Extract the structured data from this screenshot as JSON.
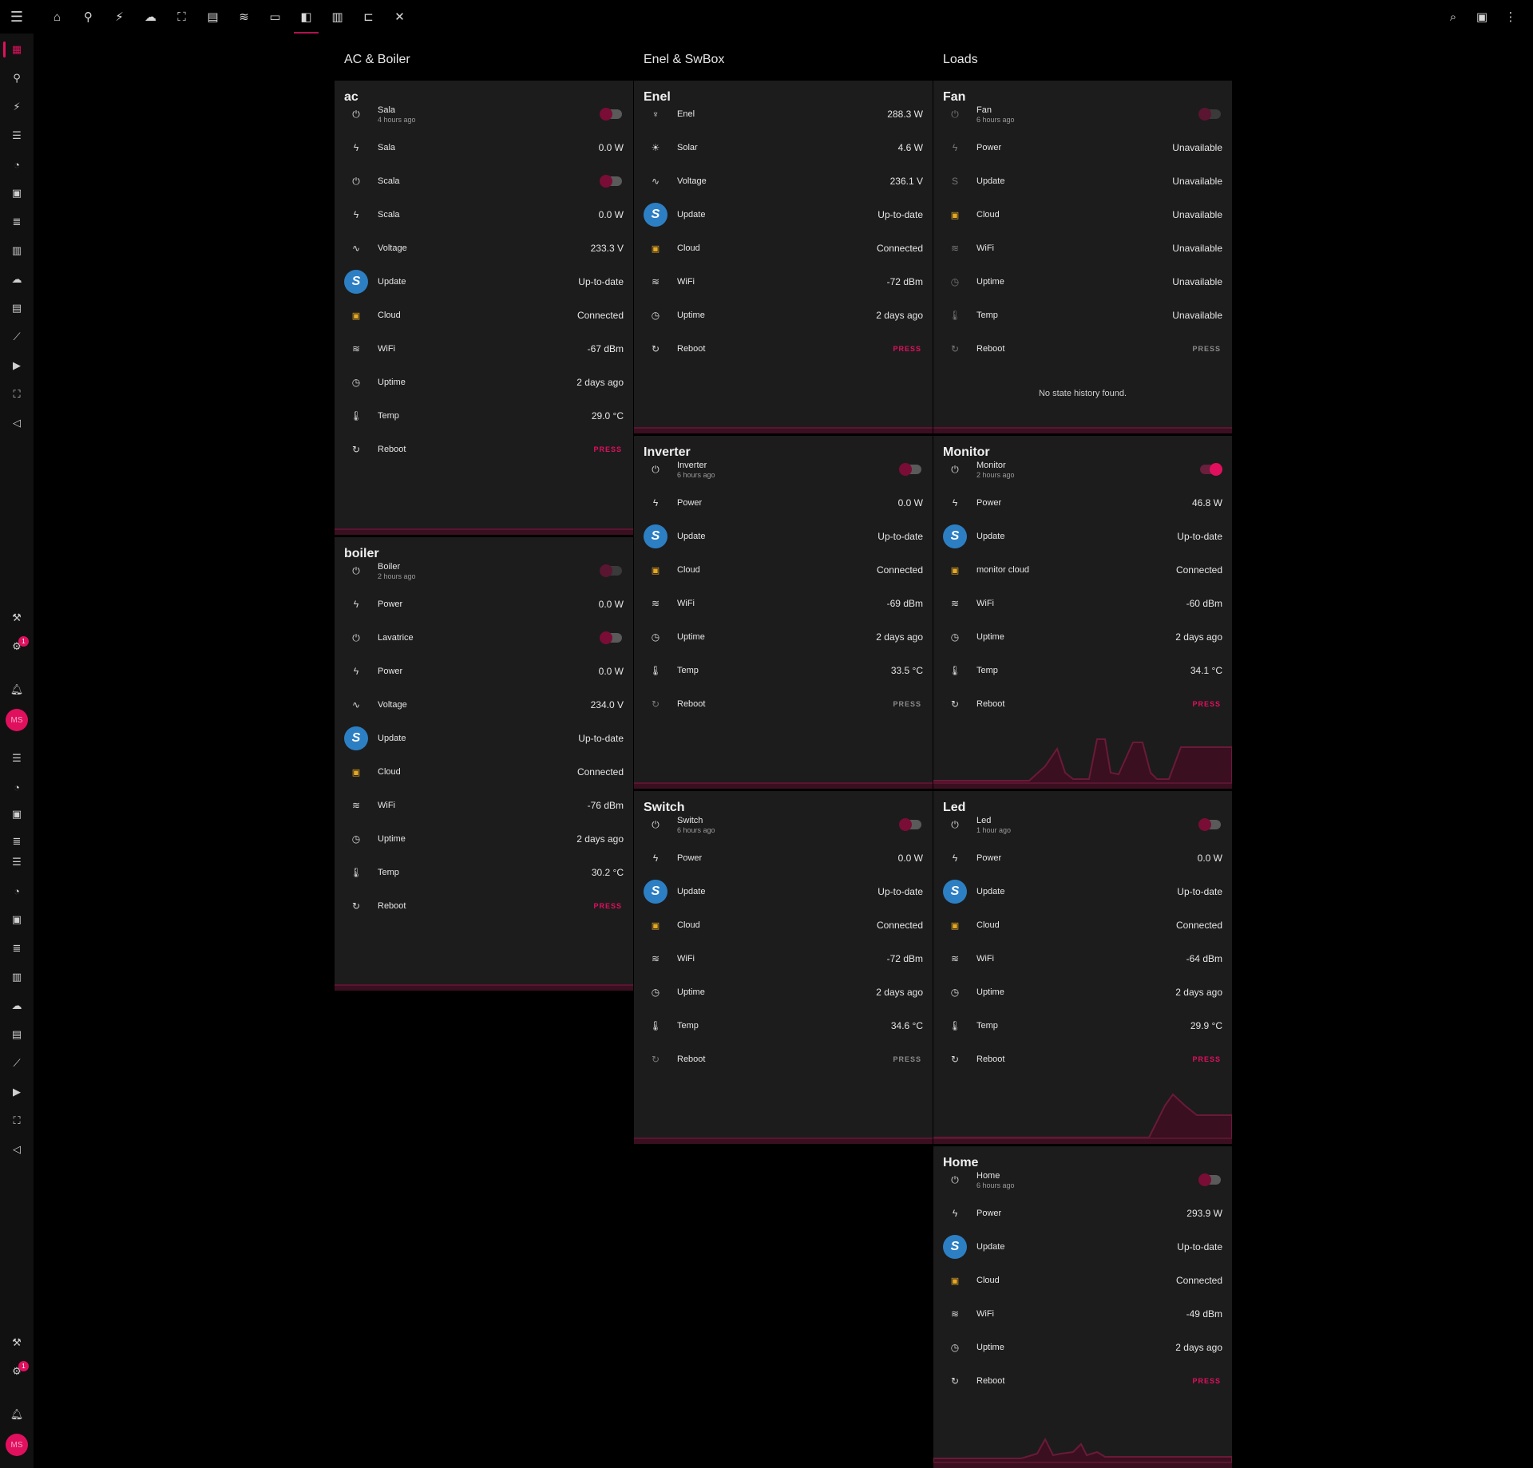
{
  "topbar": {
    "menu_icon": "menu-icon",
    "tabs": [
      {
        "icon": "home-icon",
        "glyph": "⌂"
      },
      {
        "icon": "satellite-dish-icon",
        "glyph": "⚘"
      },
      {
        "icon": "power-plug-icon",
        "glyph": "✎"
      },
      {
        "icon": "weather-partly-cloudy-icon",
        "glyph": "☁"
      },
      {
        "icon": "lan-icon",
        "glyph": "⛶"
      },
      {
        "icon": "printer-icon",
        "glyph": "▤"
      },
      {
        "icon": "radiator-icon",
        "glyph": "≋"
      },
      {
        "icon": "cast-icon",
        "glyph": "▭"
      },
      {
        "icon": "nintendo-switch-icon",
        "glyph": "◧"
      },
      {
        "icon": "book-open-icon",
        "glyph": "▥"
      },
      {
        "icon": "file-tree-icon",
        "glyph": "⊏"
      },
      {
        "icon": "tools-icon",
        "glyph": "✕"
      }
    ],
    "active_tab": 8,
    "right_icons": [
      "search-icon",
      "assist-icon",
      "more-vert-icon"
    ]
  },
  "sidebar": {
    "avatar_initials": "MS",
    "badge_count": "1"
  },
  "columns": {
    "col1": "AC & Boiler",
    "col2": "Enel & SwBox",
    "col3": "Loads"
  },
  "cards": {
    "ac": {
      "title": "ac",
      "rows": [
        {
          "label": "Sala",
          "sub": "4 hours ago"
        },
        {
          "label": "Sala",
          "value": "0.0 W"
        },
        {
          "label": "Scala"
        },
        {
          "label": "Scala",
          "value": "0.0 W"
        },
        {
          "label": "Voltage",
          "value": "233.3 V"
        },
        {
          "label": "Update",
          "value": "Up-to-date"
        },
        {
          "label": "Cloud",
          "value": "Connected"
        },
        {
          "label": "WiFi",
          "value": "-67 dBm"
        },
        {
          "label": "Uptime",
          "value": "2 days ago"
        },
        {
          "label": "Temp",
          "value": "29.0 °C"
        },
        {
          "label": "Reboot",
          "value": "PRESS"
        }
      ]
    },
    "boiler": {
      "title": "boiler",
      "rows": [
        {
          "label": "Boiler",
          "sub": "2 hours ago"
        },
        {
          "label": "Power",
          "value": "0.0 W"
        },
        {
          "label": "Lavatrice"
        },
        {
          "label": "Power",
          "value": "0.0 W"
        },
        {
          "label": "Voltage",
          "value": "234.0 V"
        },
        {
          "label": "Update",
          "value": "Up-to-date"
        },
        {
          "label": "Cloud",
          "value": "Connected"
        },
        {
          "label": "WiFi",
          "value": "-76 dBm"
        },
        {
          "label": "Uptime",
          "value": "2 days ago"
        },
        {
          "label": "Temp",
          "value": "30.2 °C"
        },
        {
          "label": "Reboot",
          "value": "PRESS"
        }
      ]
    },
    "enel": {
      "title": "Enel",
      "rows": [
        {
          "label": "Enel",
          "value": "288.3 W"
        },
        {
          "label": "Solar",
          "value": "4.6 W"
        },
        {
          "label": "Voltage",
          "value": "236.1 V"
        },
        {
          "label": "Update",
          "value": "Up-to-date"
        },
        {
          "label": "Cloud",
          "value": "Connected"
        },
        {
          "label": "WiFi",
          "value": "-72 dBm"
        },
        {
          "label": "Uptime",
          "value": "2 days ago"
        },
        {
          "label": "Reboot",
          "value": "PRESS"
        }
      ]
    },
    "inverter": {
      "title": "Inverter",
      "rows": [
        {
          "label": "Inverter",
          "sub": "6 hours ago"
        },
        {
          "label": "Power",
          "value": "0.0 W"
        },
        {
          "label": "Update",
          "value": "Up-to-date"
        },
        {
          "label": "Cloud",
          "value": "Connected"
        },
        {
          "label": "WiFi",
          "value": "-69 dBm"
        },
        {
          "label": "Uptime",
          "value": "2 days ago"
        },
        {
          "label": "Temp",
          "value": "33.5 °C"
        },
        {
          "label": "Reboot",
          "value": "PRESS"
        }
      ]
    },
    "switch": {
      "title": "Switch",
      "rows": [
        {
          "label": "Switch",
          "sub": "6 hours ago"
        },
        {
          "label": "Power",
          "value": "0.0 W"
        },
        {
          "label": "Update",
          "value": "Up-to-date"
        },
        {
          "label": "Cloud",
          "value": "Connected"
        },
        {
          "label": "WiFi",
          "value": "-72 dBm"
        },
        {
          "label": "Uptime",
          "value": "2 days ago"
        },
        {
          "label": "Temp",
          "value": "34.6 °C"
        },
        {
          "label": "Reboot",
          "value": "PRESS"
        }
      ]
    },
    "fan": {
      "title": "Fan",
      "rows": [
        {
          "label": "Fan",
          "sub": "6 hours ago"
        },
        {
          "label": "Power",
          "value": "Unavailable"
        },
        {
          "label": "Update",
          "value": "Unavailable"
        },
        {
          "label": "Cloud",
          "value": "Unavailable"
        },
        {
          "label": "WiFi",
          "value": "Unavailable"
        },
        {
          "label": "Uptime",
          "value": "Unavailable"
        },
        {
          "label": "Temp",
          "value": "Unavailable"
        },
        {
          "label": "Reboot",
          "value": "PRESS"
        }
      ],
      "no_history": "No state history found."
    },
    "monitor": {
      "title": "Monitor",
      "rows": [
        {
          "label": "Monitor",
          "sub": "2 hours ago"
        },
        {
          "label": "Power",
          "value": "46.8 W"
        },
        {
          "label": "Update",
          "value": "Up-to-date"
        },
        {
          "label": "monitor cloud",
          "value": "Connected"
        },
        {
          "label": "WiFi",
          "value": "-60 dBm"
        },
        {
          "label": "Uptime",
          "value": "2 days ago"
        },
        {
          "label": "Temp",
          "value": "34.1 °C"
        },
        {
          "label": "Reboot",
          "value": "PRESS"
        }
      ]
    },
    "led": {
      "title": "Led",
      "rows": [
        {
          "label": "Led",
          "sub": "1 hour ago"
        },
        {
          "label": "Power",
          "value": "0.0 W"
        },
        {
          "label": "Update",
          "value": "Up-to-date"
        },
        {
          "label": "Cloud",
          "value": "Connected"
        },
        {
          "label": "WiFi",
          "value": "-64 dBm"
        },
        {
          "label": "Uptime",
          "value": "2 days ago"
        },
        {
          "label": "Temp",
          "value": "29.9 °C"
        },
        {
          "label": "Reboot",
          "value": "PRESS"
        }
      ]
    },
    "home": {
      "title": "Home",
      "rows": [
        {
          "label": "Home",
          "sub": "6 hours ago"
        },
        {
          "label": "Power",
          "value": "293.9 W"
        },
        {
          "label": "Update",
          "value": "Up-to-date"
        },
        {
          "label": "Cloud",
          "value": "Connected"
        },
        {
          "label": "WiFi",
          "value": "-49 dBm"
        },
        {
          "label": "Uptime",
          "value": "2 days ago"
        },
        {
          "label": "Reboot",
          "value": "PRESS"
        }
      ]
    }
  },
  "colors": {
    "accent": "#e0105e",
    "card_bg": "#1c1c1c",
    "cloud_icon": "#e6a822",
    "update_logo": "#2d7fc4"
  }
}
